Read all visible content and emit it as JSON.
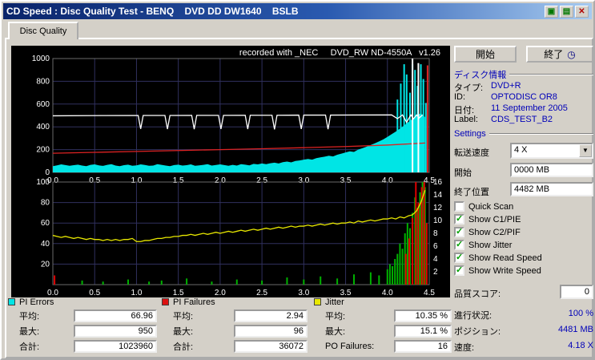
{
  "window": {
    "title": "CD Speed : Disc Quality Test - BENQ    DVD DD DW1640    BSLB",
    "controls": [
      {
        "name": "titlebar-green-button-1",
        "glyph": "▣"
      },
      {
        "name": "titlebar-green-button-2",
        "glyph": "▤"
      },
      {
        "name": "close-button",
        "glyph": "✕"
      }
    ]
  },
  "tab": {
    "label": "Disc Quality"
  },
  "chart_header": "recorded with _NEC     DVD_RW ND-4550A   v1.26",
  "right_panel": {
    "start_button": "開始",
    "exit_button": "終了",
    "exit_icon": "◷",
    "disc_info": {
      "header": "ディスク情報",
      "rows": [
        {
          "label": "タイプ:",
          "value": "DVD+R"
        },
        {
          "label": "ID:",
          "value": "OPTODISC OR8"
        },
        {
          "label": "日付:",
          "value": "11 September 2005"
        },
        {
          "label": "Label:",
          "value": "CDS_TEST_B2"
        }
      ]
    },
    "settings": {
      "header": "Settings",
      "speed_label": "転送速度",
      "speed_value": "4 X",
      "start_label": "開始",
      "start_value": "0000 MB",
      "end_label": "終了位置",
      "end_value": "4482 MB",
      "checkboxes": [
        {
          "label": "Quick Scan",
          "checked": false
        },
        {
          "label": "Show C1/PIE",
          "checked": true
        },
        {
          "label": "Show C2/PIF",
          "checked": true
        },
        {
          "label": "Show Jitter",
          "checked": true
        },
        {
          "label": "Show Read Speed",
          "checked": true
        },
        {
          "label": "Show Write Speed",
          "checked": true
        }
      ]
    },
    "quality_score": {
      "label": "品質スコア:",
      "value": "0"
    },
    "status": [
      {
        "label": "進行状況:",
        "value": "100 %"
      },
      {
        "label": "ポジション:",
        "value": "4481 MB"
      },
      {
        "label": "速度:",
        "value": "4.18 X"
      }
    ]
  },
  "legend_panels": [
    {
      "name": "PI Errors",
      "color": "#00e5e5",
      "rows": [
        [
          "平均:",
          "66.96"
        ],
        [
          "最大:",
          "950"
        ],
        [
          "合計:",
          "1023960"
        ]
      ]
    },
    {
      "name": "PI Failures",
      "color": "#dd1111",
      "rows": [
        [
          "平均:",
          "2.94"
        ],
        [
          "最大:",
          "96"
        ],
        [
          "合計:",
          "36072"
        ]
      ]
    },
    {
      "name": "Jitter",
      "color": "#e8e800",
      "rows": [
        [
          "平均:",
          "10.35 %"
        ],
        [
          "最大:",
          "15.1 %"
        ],
        [
          "PO Failures:",
          "16"
        ]
      ]
    }
  ],
  "chart_data": [
    {
      "type": "area",
      "name": "pi-errors-chart",
      "x_range": [
        0,
        4.5
      ],
      "y_range": [
        0,
        1000
      ],
      "x_ticks": [
        "0.0",
        "0.5",
        "1.0",
        "1.5",
        "2.0",
        "2.5",
        "3.0",
        "3.5",
        "4.0",
        "4.5"
      ],
      "y_ticks": [
        0,
        200,
        400,
        600,
        800,
        1000
      ],
      "series": [
        {
          "name": "PI Errors",
          "type": "area",
          "color": "#00e5e5",
          "x0": 0,
          "dx": 0.05,
          "values": [
            55,
            62,
            70,
            64,
            58,
            63,
            68,
            60,
            55,
            66,
            70,
            62,
            57,
            66,
            72,
            60,
            55,
            63,
            68,
            58,
            62,
            70,
            65,
            58,
            60,
            72,
            66,
            60,
            55,
            64,
            68,
            60,
            63,
            70,
            58,
            62,
            66,
            72,
            60,
            65,
            70,
            64,
            58,
            66,
            60,
            72,
            68,
            62,
            75,
            70,
            78,
            72,
            80,
            85,
            78,
            90,
            95,
            88,
            100,
            105,
            112,
            118,
            112,
            125,
            132,
            138,
            146,
            140,
            155,
            165,
            175,
            185,
            180,
            200,
            212,
            225,
            240,
            255,
            272,
            290,
            312,
            335,
            358,
            385,
            412,
            442,
            470,
            498,
            520,
            485
          ]
        },
        {
          "name": "PI Error spikes",
          "type": "bars",
          "color": "#00e5e5",
          "bars": [
            [
              4.12,
              640
            ],
            [
              4.16,
              780
            ],
            [
              4.2,
              950
            ],
            [
              4.23,
              860
            ],
            [
              4.27,
              700
            ],
            [
              4.3,
              950
            ],
            [
              4.33,
              900
            ],
            [
              4.36,
              760
            ],
            [
              4.4,
              950
            ],
            [
              4.43,
              820
            ],
            [
              4.46,
              610
            ]
          ]
        },
        {
          "name": "Write Speed",
          "type": "line",
          "color": "#dd2222",
          "points": [
            [
              0,
              168
            ],
            [
              0.5,
              176
            ],
            [
              1.0,
              184
            ],
            [
              1.5,
              192
            ],
            [
              2.0,
              200
            ],
            [
              2.5,
              208
            ],
            [
              3.0,
              217
            ],
            [
              3.5,
              227
            ],
            [
              4.0,
              240
            ],
            [
              4.3,
              252
            ],
            [
              4.45,
              258
            ]
          ]
        },
        {
          "name": "Write Speed end spike",
          "type": "bars",
          "color": "#dd2222",
          "bars": [
            [
              4.48,
              940
            ]
          ]
        },
        {
          "name": "Read Speed spikes",
          "type": "bars",
          "color": "#ffffff",
          "bars": [
            [
              4.3,
              1000
            ],
            [
              4.37,
              960
            ]
          ]
        },
        {
          "name": "Read Speed",
          "type": "line",
          "color": "#ffffff",
          "points": [
            [
              0,
              497
            ],
            [
              0.6,
              499
            ],
            [
              1.02,
              500
            ],
            [
              1.05,
              382
            ],
            [
              1.08,
              500
            ],
            [
              1.34,
              500
            ],
            [
              1.37,
              380
            ],
            [
              1.4,
              500
            ],
            [
              1.66,
              501
            ],
            [
              1.69,
              379
            ],
            [
              1.72,
              501
            ],
            [
              1.98,
              501
            ],
            [
              2.01,
              381
            ],
            [
              2.04,
              501
            ],
            [
              2.3,
              502
            ],
            [
              2.33,
              380
            ],
            [
              2.36,
              502
            ],
            [
              2.62,
              502
            ],
            [
              2.65,
              378
            ],
            [
              2.68,
              502
            ],
            [
              2.94,
              503
            ],
            [
              2.97,
              381
            ],
            [
              3.0,
              503
            ],
            [
              3.26,
              503
            ],
            [
              3.29,
              379
            ],
            [
              3.32,
              503
            ],
            [
              3.6,
              504
            ],
            [
              4.05,
              505
            ],
            [
              4.12,
              472
            ],
            [
              4.18,
              505
            ],
            [
              4.23,
              440
            ],
            [
              4.28,
              505
            ],
            [
              4.31,
              470
            ],
            [
              4.35,
              505
            ],
            [
              4.38,
              478
            ],
            [
              4.42,
              505
            ]
          ]
        }
      ]
    },
    {
      "type": "line",
      "name": "jitter-chart",
      "x_range": [
        0,
        4.5
      ],
      "y_range": [
        0,
        100
      ],
      "y_right_range": [
        0,
        16
      ],
      "x_ticks": [
        "0.0",
        "0.5",
        "1.0",
        "1.5",
        "2.0",
        "2.5",
        "3.0",
        "3.5",
        "4.0",
        "4.5"
      ],
      "y_ticks": [
        20,
        40,
        60,
        80,
        100
      ],
      "y_right_ticks": [
        2,
        4,
        6,
        8,
        10,
        12,
        14,
        16
      ],
      "series": [
        {
          "name": "PI Failures",
          "type": "bars",
          "color": "#00b000",
          "bars": [
            [
              0.35,
              4
            ],
            [
              0.6,
              3
            ],
            [
              0.9,
              5
            ],
            [
              1.15,
              3
            ],
            [
              1.3,
              4
            ],
            [
              1.6,
              6
            ],
            [
              1.9,
              3
            ],
            [
              2.2,
              5
            ],
            [
              2.5,
              4
            ],
            [
              2.8,
              7
            ],
            [
              3.0,
              5
            ],
            [
              3.2,
              8
            ],
            [
              3.4,
              6
            ],
            [
              3.6,
              10
            ],
            [
              3.8,
              12
            ],
            [
              3.9,
              9
            ],
            [
              4.0,
              15
            ],
            [
              4.03,
              20
            ],
            [
              4.06,
              18
            ],
            [
              4.09,
              25
            ],
            [
              4.12,
              30
            ],
            [
              4.15,
              40
            ],
            [
              4.18,
              35
            ],
            [
              4.21,
              50
            ],
            [
              4.24,
              60
            ],
            [
              4.27,
              55
            ],
            [
              4.3,
              70
            ],
            [
              4.33,
              85
            ],
            [
              4.36,
              75
            ],
            [
              4.39,
              90
            ],
            [
              4.42,
              100
            ],
            [
              4.45,
              95
            ]
          ]
        },
        {
          "name": "PO Failures",
          "type": "bars",
          "color": "#e00000",
          "bars": [
            [
              0.02,
              9
            ],
            [
              4.22,
              30
            ],
            [
              4.26,
              45
            ],
            [
              4.3,
              65
            ],
            [
              4.34,
              100
            ],
            [
              4.37,
              80
            ],
            [
              4.41,
              95
            ],
            [
              4.44,
              100
            ],
            [
              4.47,
              60
            ]
          ]
        },
        {
          "name": "Jitter",
          "type": "line",
          "color": "#e8e800",
          "x0": 0,
          "dx": 0.05,
          "values": [
            48,
            47,
            46,
            47,
            46,
            45,
            46,
            45,
            44,
            45,
            44,
            44,
            43,
            44,
            43,
            44,
            43,
            44,
            44,
            45,
            42,
            42,
            43,
            43,
            44,
            45,
            45,
            46,
            46,
            47,
            47,
            48,
            48,
            49,
            48,
            49,
            50,
            49,
            50,
            51,
            50,
            51,
            52,
            51,
            52,
            53,
            52,
            53,
            54,
            53,
            54,
            55,
            54,
            55,
            56,
            55,
            56,
            57,
            56,
            57,
            57,
            58,
            57,
            58,
            59,
            58,
            59,
            60,
            59,
            60,
            60,
            61,
            60,
            62,
            61,
            62,
            63,
            62,
            63,
            64,
            64,
            65,
            64,
            66,
            65,
            67,
            68,
            72,
            80,
            92
          ]
        }
      ]
    }
  ]
}
